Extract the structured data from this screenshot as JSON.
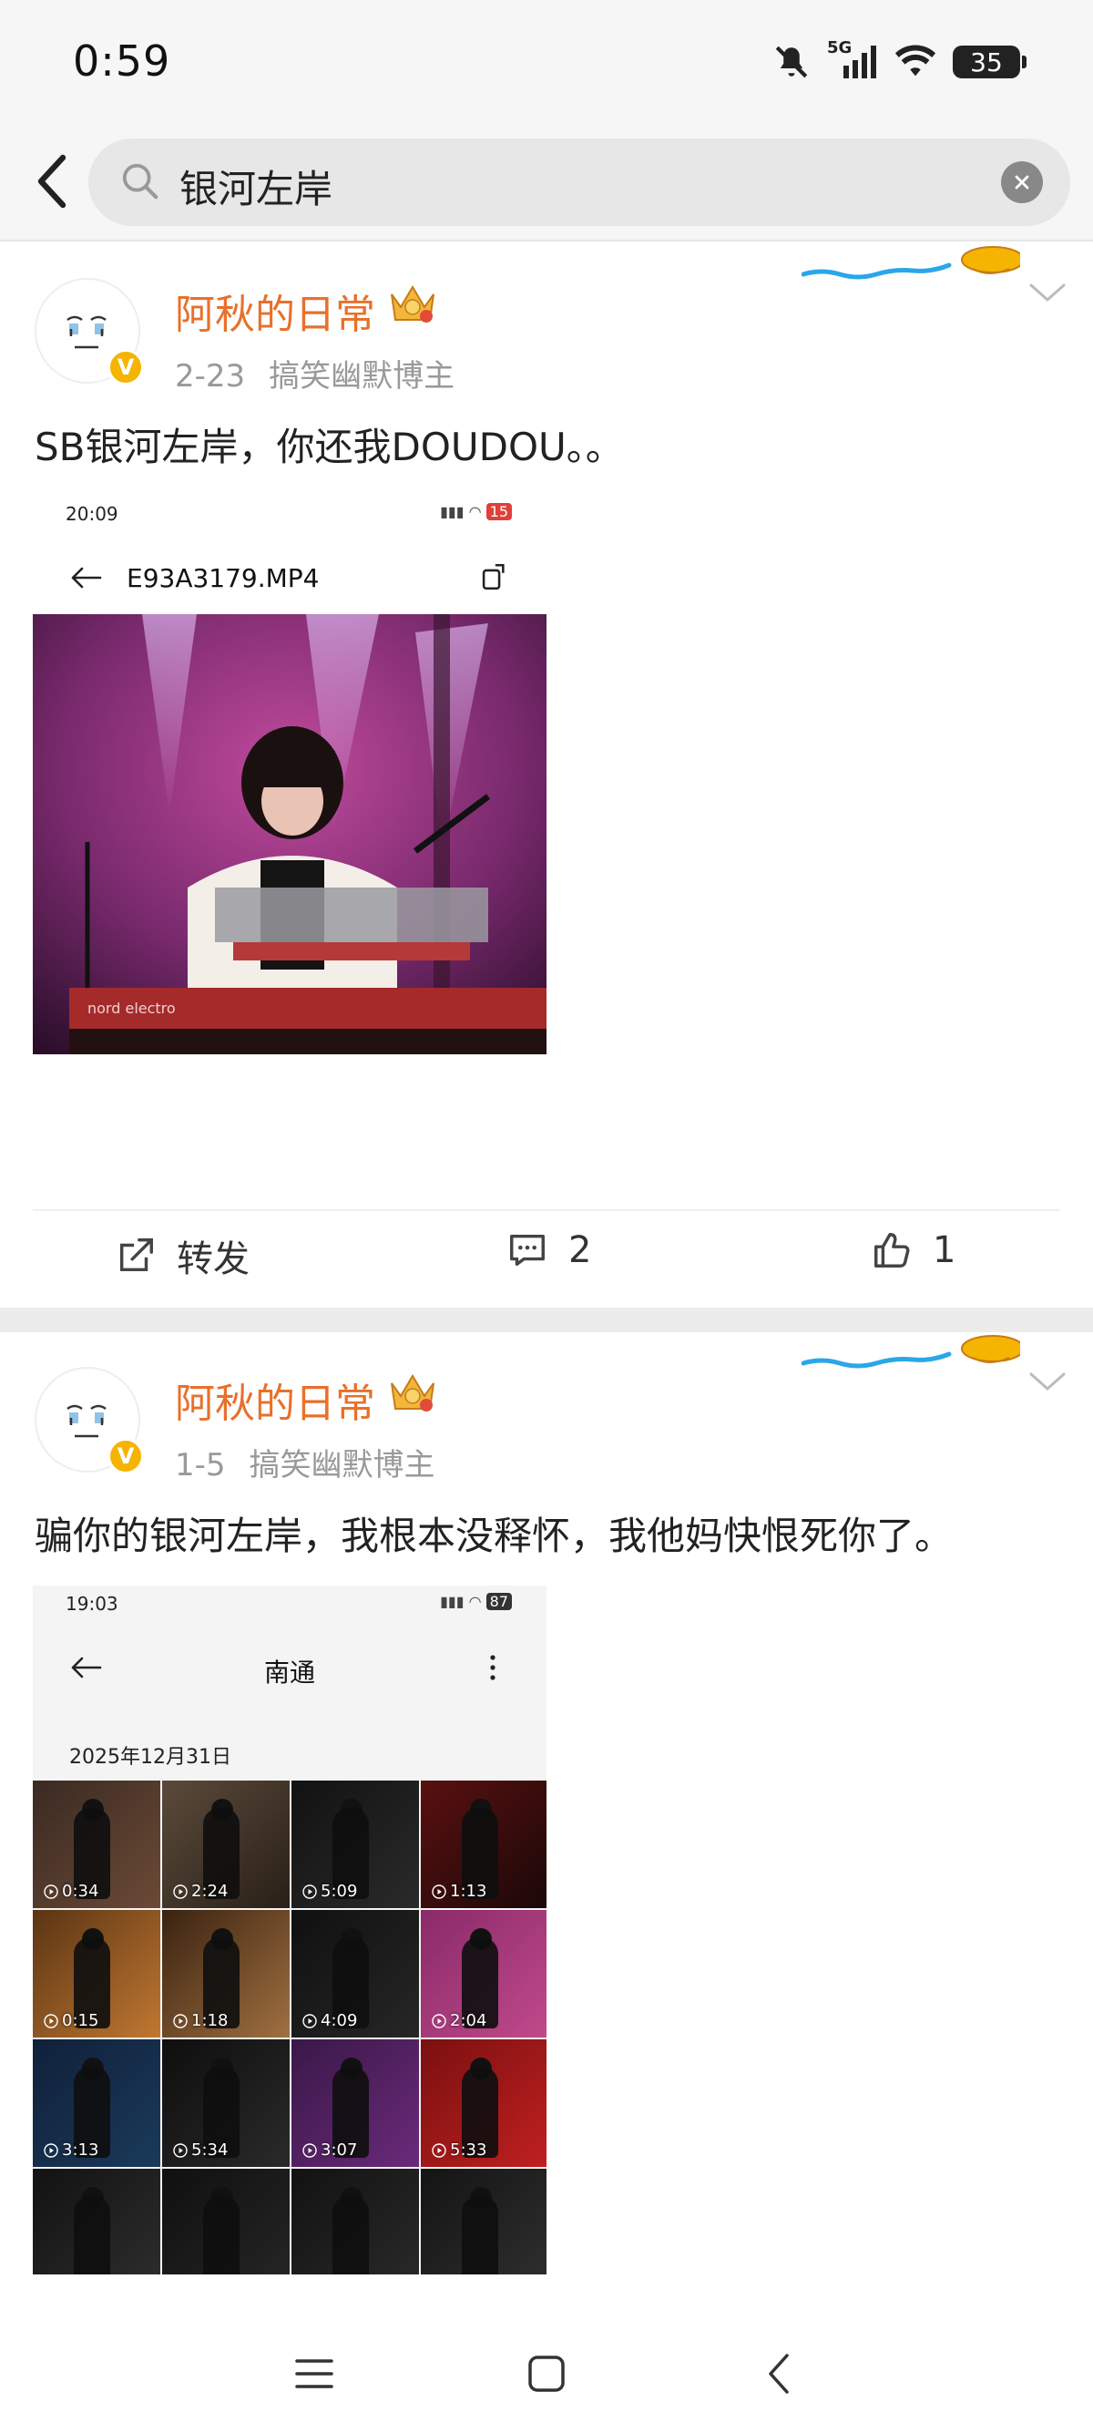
{
  "status": {
    "time": "0:59",
    "network": "5G",
    "battery": "35"
  },
  "search": {
    "query": "银河左岸"
  },
  "posts": [
    {
      "author": "阿秋的日常",
      "date": "2-23",
      "tag": "搞笑幽默博主",
      "text": "SB银河左岸，你还我DOUDOU。。",
      "embed": {
        "time": "20:09",
        "battery": "15",
        "title": "E93A3179.MP4"
      },
      "actions": {
        "repost": "转发",
        "comments": "2",
        "likes": "1"
      }
    },
    {
      "author": "阿秋的日常",
      "date": "1-5",
      "tag": "搞笑幽默博主",
      "text": "骗你的银河左岸，我根本没释怀，我他妈快恨死你了。",
      "embed": {
        "time": "19:03",
        "battery": "87",
        "title": "南通",
        "date": "2025年12月31日",
        "durations": [
          "0:34",
          "2:24",
          "5:09",
          "1:13",
          "0:15",
          "1:18",
          "4:09",
          "2:04",
          "3:13",
          "5:34",
          "3:07",
          "5:33",
          "",
          "",
          "",
          ""
        ]
      }
    }
  ],
  "icons": {
    "back": "chevron-left-icon",
    "search": "search-icon",
    "clear": "close-icon",
    "repost": "share-icon",
    "comment": "comment-icon",
    "like": "thumbs-up-icon",
    "crown": "crown-badge-icon",
    "verified": "verified-v-icon"
  },
  "colors": {
    "username": "#e8702a",
    "verified": "#f5b400",
    "meta": "#999999"
  }
}
